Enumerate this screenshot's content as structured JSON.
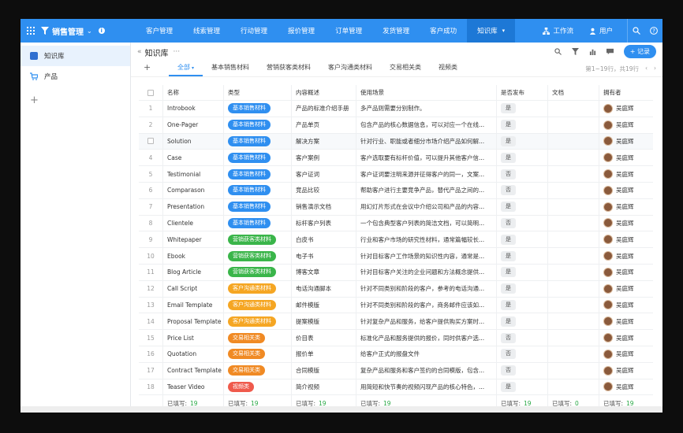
{
  "app": {
    "title": "销售管理"
  },
  "nav": {
    "tabs": [
      "客户管理",
      "线索管理",
      "行动管理",
      "报价管理",
      "订单管理",
      "发货管理",
      "客户成功",
      "知识库"
    ],
    "active_index": 7,
    "workflow": "工作流",
    "user": "用户"
  },
  "sidebar": {
    "items": [
      {
        "label": "知识库"
      },
      {
        "label": "产品"
      }
    ]
  },
  "main": {
    "title": "知识库",
    "record_button": "+ 记录",
    "subtabs": [
      "全部",
      "基本销售材料",
      "营销获客类材料",
      "客户沟通类材料",
      "交易相关类",
      "视频类"
    ],
    "pager": "第1~19行，共19行"
  },
  "table": {
    "headers": [
      "名称",
      "类型",
      "内容概述",
      "使用场景",
      "是否发布",
      "文档",
      "拥有者"
    ],
    "tag_colors": {
      "基本销售材料": "#2f8ff0",
      "营销获客类材料": "#3ab54a",
      "客户沟通类材料": "#f5a623",
      "交易相关类": "#f08a24",
      "视频类": "#ef5a4c"
    },
    "rows": [
      {
        "no": "1",
        "name": "Introbook",
        "type": "基本销售材料",
        "summary": "产品的标准介绍手册",
        "scene": "多产品则需要分别制作。",
        "pub": "是",
        "owner": "吴庭辉"
      },
      {
        "no": "2",
        "name": "One-Pager",
        "type": "基本销售材料",
        "summary": "产品单页",
        "scene": "包含产品的核心数据信息，可以对应一个在线...",
        "pub": "是",
        "owner": "吴庭辉"
      },
      {
        "no": "",
        "name": "Solution",
        "type": "基本销售材料",
        "summary": "解决方案",
        "scene": "针对行业、职能或者细分市场介绍产品如何解...",
        "pub": "是",
        "owner": "吴庭辉"
      },
      {
        "no": "4",
        "name": "Case",
        "type": "基本销售材料",
        "summary": "客户案例",
        "scene": "客户选取要有标杆价值，可以提升其他客户信...",
        "pub": "是",
        "owner": "吴庭辉"
      },
      {
        "no": "5",
        "name": "Testimonial",
        "type": "基本销售材料",
        "summary": "客户证词",
        "scene": "客户证词要注明来源并征得客户的同一，文案...",
        "pub": "否",
        "owner": "吴庭辉"
      },
      {
        "no": "6",
        "name": "Comparason",
        "type": "基本销售材料",
        "summary": "竞品比较",
        "scene": "帮助客户进行主要竞争产品，替代产品之间的...",
        "pub": "否",
        "owner": "吴庭辉"
      },
      {
        "no": "7",
        "name": "Presentation",
        "type": "基本销售材料",
        "summary": "销售演示文档",
        "scene": "用幻灯片形式在会议中介绍公司和产品的内容...",
        "pub": "是",
        "owner": "吴庭辉"
      },
      {
        "no": "8",
        "name": "Clientele",
        "type": "基本销售材料",
        "summary": "标杆客户列表",
        "scene": "一个包含典型客户列表的简洁文档，可以简明...",
        "pub": "否",
        "owner": "吴庭辉"
      },
      {
        "no": "9",
        "name": "Whitepaper",
        "type": "营销获客类材料",
        "summary": "白皮书",
        "scene": "行业和客户市场的研究性材料，通常篇幅较长...",
        "pub": "是",
        "owner": "吴庭辉"
      },
      {
        "no": "10",
        "name": "Ebook",
        "type": "营销获客类材料",
        "summary": "电子书",
        "scene": "针对目标客户工作场景的知识性内容，通常是...",
        "pub": "是",
        "owner": "吴庭辉"
      },
      {
        "no": "11",
        "name": "Blog Article",
        "type": "营销获客类材料",
        "summary": "博客文章",
        "scene": "针对目标客户关注的企业问题和方法概念提供...",
        "pub": "是",
        "owner": "吴庭辉"
      },
      {
        "no": "12",
        "name": "Call Script",
        "type": "客户沟通类材料",
        "summary": "电话沟通脚本",
        "scene": "针对不同类别和阶段的客户，参考的电话沟通...",
        "pub": "是",
        "owner": "吴庭辉"
      },
      {
        "no": "13",
        "name": "Email Template",
        "type": "客户沟通类材料",
        "summary": "邮件模版",
        "scene": "针对不同类别和阶段的客户，商务邮件应该如...",
        "pub": "是",
        "owner": "吴庭辉"
      },
      {
        "no": "14",
        "name": "Proposal Template",
        "type": "客户沟通类材料",
        "summary": "提案模版",
        "scene": "针对复杂产品和服务，给客户提供购买方案时...",
        "pub": "是",
        "owner": "吴庭辉"
      },
      {
        "no": "15",
        "name": "Price List",
        "type": "交易相关类",
        "summary": "价目表",
        "scene": "标准化产品和服务提供的报价，同时供客户选...",
        "pub": "否",
        "owner": "吴庭辉"
      },
      {
        "no": "16",
        "name": "Quotation",
        "type": "交易相关类",
        "summary": "报价单",
        "scene": "给客户正式的报盘文件",
        "pub": "否",
        "owner": "吴庭辉"
      },
      {
        "no": "17",
        "name": "Contract Template",
        "type": "交易相关类",
        "summary": "合同模版",
        "scene": "复杂产品和服务和客户签约的合同模版，包含...",
        "pub": "否",
        "owner": "吴庭辉"
      },
      {
        "no": "18",
        "name": "Teaser Video",
        "type": "视频类",
        "summary": "简介视频",
        "scene": "用简短和快节奏的视频闪现产品的核心特色，...",
        "pub": "是",
        "owner": "吴庭辉"
      }
    ],
    "footer": {
      "label": "已填写:",
      "counts": [
        "19",
        "19",
        "19",
        "19",
        "19",
        "0",
        "19"
      ]
    }
  }
}
